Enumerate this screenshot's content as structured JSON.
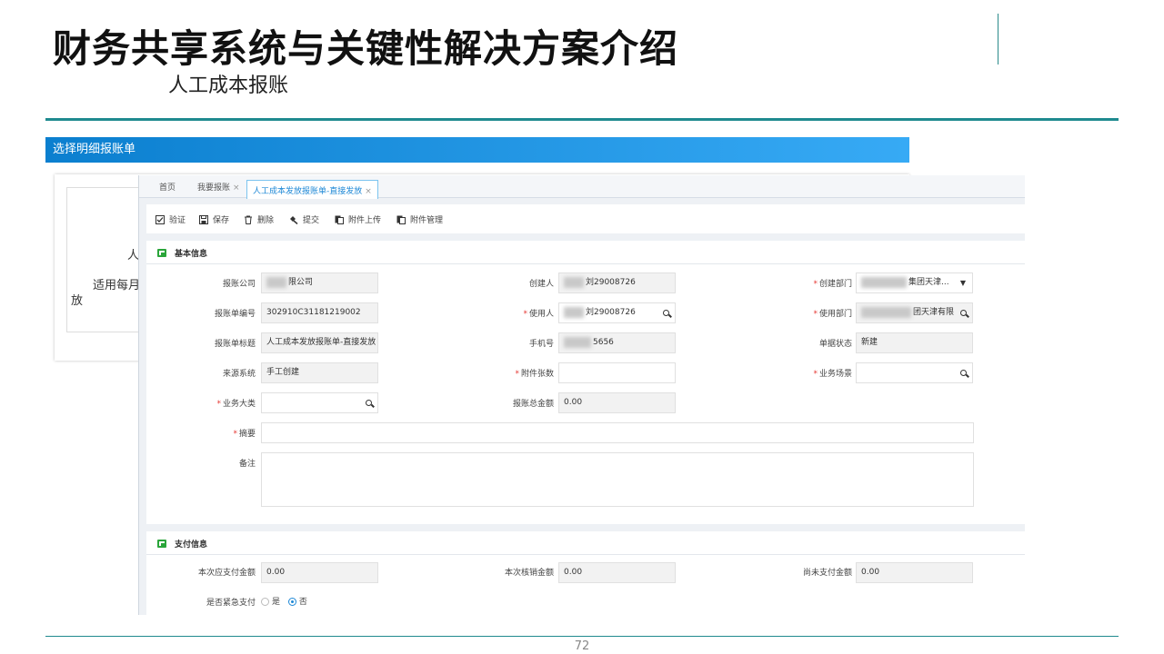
{
  "slide": {
    "title": "财务共享系统与关键性解决方案介绍",
    "subtitle": "人工成本报账",
    "page_number": "72"
  },
  "banner": {
    "label": "选择明细报账单"
  },
  "behind": {
    "text1": "人",
    "text2": "适用每月",
    "text3": "放"
  },
  "tabs": [
    {
      "label": "首页"
    },
    {
      "label": "我要报账",
      "close": "×"
    },
    {
      "label": "人工成本发放报账单-直接发放",
      "close": "×"
    }
  ],
  "toolbar": {
    "validate": "验证",
    "save": "保存",
    "delete": "删除",
    "submit": "提交",
    "upload": "附件上传",
    "manage": "附件管理"
  },
  "basic": {
    "title": "基本信息",
    "company_label": "报账公司",
    "company_value": "限公司",
    "creator_label": "创建人",
    "creator_value": "刘29008726",
    "create_dept_label": "创建部门",
    "create_dept_value": "集团天津...",
    "bill_no_label": "报账单编号",
    "bill_no_value": "302910C31181219002",
    "user_label": "使用人",
    "user_value": "刘29008726",
    "use_dept_label": "使用部门",
    "use_dept_value": "团天津有限",
    "bill_title_label": "报账单标题",
    "bill_title_value": "人工成本发放报账单-直接发放",
    "phone_label": "手机号",
    "phone_value": "5656",
    "status_label": "单据状态",
    "status_value": "新建",
    "source_label": "来源系统",
    "source_value": "手工创建",
    "attach_label": "附件张数",
    "attach_value": "",
    "scene_label": "业务场景",
    "scene_value": "",
    "category_label": "业务大类",
    "category_value": "",
    "total_label": "报账总金额",
    "total_value": "0.00",
    "summary_label": "摘要",
    "summary_value": "",
    "remark_label": "备注",
    "remark_value": ""
  },
  "payment": {
    "title": "支付信息",
    "due_label": "本次应支付金额",
    "due_value": "0.00",
    "verify_label": "本次核销金额",
    "verify_value": "0.00",
    "unpaid_label": "尚未支付金额",
    "unpaid_value": "0.00",
    "urgent_label": "是否紧急支付",
    "urgent_yes": "是",
    "urgent_no": "否",
    "urgent_selected": "否"
  },
  "colors": {
    "accent": "#1e88d6",
    "required": "#e53935",
    "rule": "#1f8a8f"
  }
}
